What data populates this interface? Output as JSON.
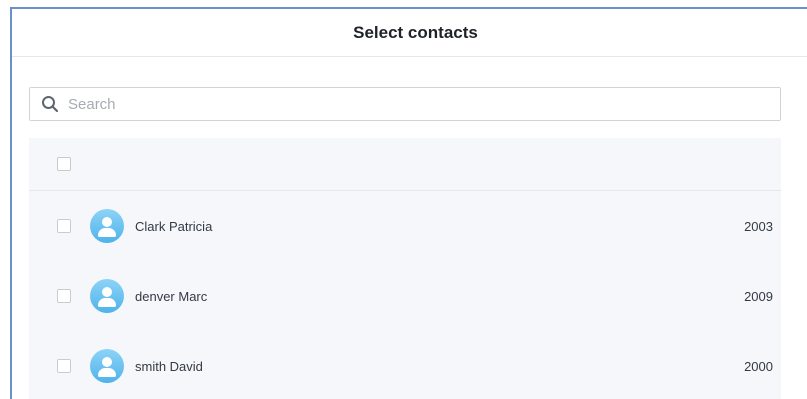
{
  "dialog": {
    "title": "Select contacts"
  },
  "search": {
    "placeholder": "Search",
    "value": ""
  },
  "contacts": [
    {
      "name": "Clark Patricia",
      "year": "2003"
    },
    {
      "name": "denver Marc",
      "year": "2009"
    },
    {
      "name": "smith David",
      "year": "2000"
    }
  ],
  "colors": {
    "accent_border": "#6b8fc9",
    "avatar": "#5bbcef",
    "list_background": "#f6f7fb"
  },
  "icons": {
    "search": "search-icon",
    "avatar": "user-avatar-icon"
  }
}
